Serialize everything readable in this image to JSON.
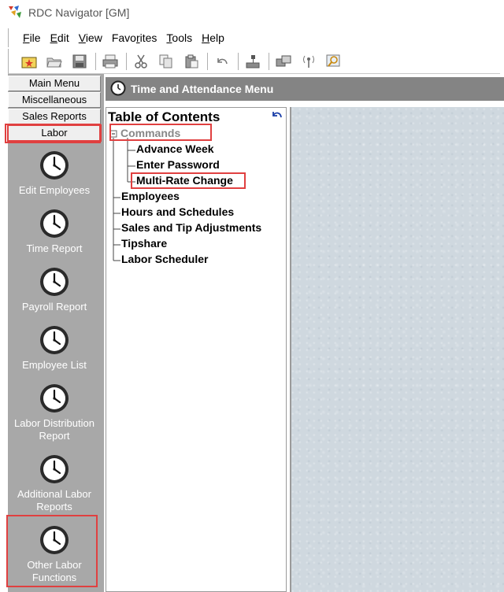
{
  "window": {
    "title": "RDC Navigator [GM]"
  },
  "menu": {
    "items": [
      {
        "pre": "",
        "u": "F",
        "post": "ile"
      },
      {
        "pre": "",
        "u": "E",
        "post": "dit"
      },
      {
        "pre": "",
        "u": "V",
        "post": "iew"
      },
      {
        "pre": "Favo",
        "u": "r",
        "post": "ites"
      },
      {
        "pre": "",
        "u": "T",
        "post": "ools"
      },
      {
        "pre": "",
        "u": "H",
        "post": "elp"
      }
    ]
  },
  "toolbar": {
    "icons": [
      "new-folder-icon",
      "open-icon",
      "save-icon",
      "print-icon",
      "cut-icon",
      "copy-icon",
      "paste-icon",
      "undo-icon",
      "tree-icon",
      "network-icon",
      "antenna-icon",
      "find-icon"
    ]
  },
  "left_nav": {
    "tabs": [
      "Main Menu",
      "Miscellaneous",
      "Sales Reports",
      "Labor"
    ],
    "items": [
      "Edit Employees",
      "Time Report",
      "Payroll Report",
      "Employee List",
      "Labor Distribution Report",
      "Additional Labor Reports",
      "Other Labor Functions"
    ]
  },
  "header": {
    "title": "Time and Attendance Menu"
  },
  "toc": {
    "title": "Table of Contents",
    "commands_label": "Commands",
    "commands_children": [
      "Advance Week",
      "Enter Password",
      "Multi-Rate Change"
    ],
    "top_items": [
      "Employees",
      "Hours and Schedules",
      "Sales and Tip Adjustments",
      "Tipshare",
      "Labor Scheduler"
    ]
  },
  "colors": {
    "highlight": "#e04040",
    "panel_gray": "#a8a8a8",
    "header_gray": "#848484"
  }
}
